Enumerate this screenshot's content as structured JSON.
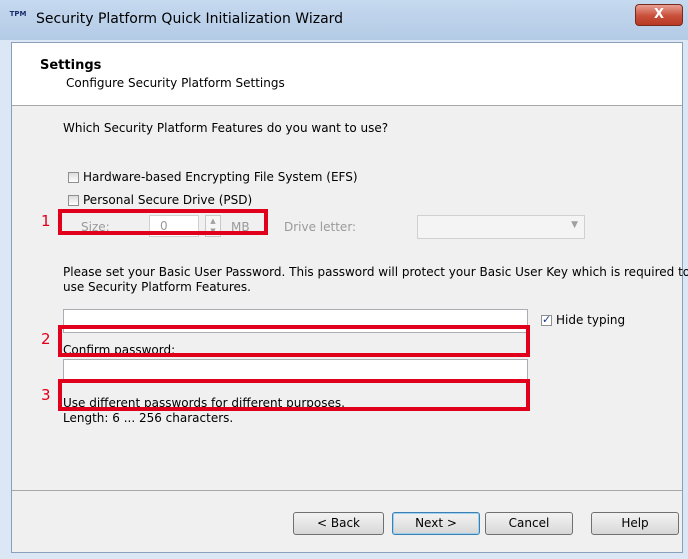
{
  "window": {
    "app_icon_label": "TPM",
    "title": "Security Platform Quick Initialization Wizard",
    "close_glyph": "X"
  },
  "header": {
    "title": "Settings",
    "subtitle": "Configure Security Platform Settings"
  },
  "body": {
    "question": "Which Security Platform Features do you want to use?",
    "efs": {
      "label": "Hardware-based Encrypting File System (EFS)",
      "checked": false
    },
    "psd": {
      "label": "Personal Secure Drive (PSD)",
      "checked": false
    },
    "size_label": "Size:",
    "size_value": "0",
    "size_unit": "MB",
    "drive_letter_label": "Drive letter:",
    "drive_letter_value": "",
    "password_instructions_line1": "Please set your Basic User Password. This password will protect your Basic User Key which is required to",
    "password_instructions_line2": "use Security Platform Features.",
    "password_value": "",
    "hide_typing": {
      "label": "Hide typing",
      "checked": true
    },
    "confirm_label": "Confirm password:",
    "confirm_value": "",
    "hint_line1": "Use different passwords for different purposes.",
    "hint_line2": "Length: 6 ... 256 characters."
  },
  "annotations": {
    "marker_1": "1",
    "marker_2": "2",
    "marker_3": "3",
    "color": "#e0001b"
  },
  "footer": {
    "back_label": "< Back",
    "next_label": "Next >",
    "cancel_label": "Cancel",
    "help_label": "Help"
  }
}
